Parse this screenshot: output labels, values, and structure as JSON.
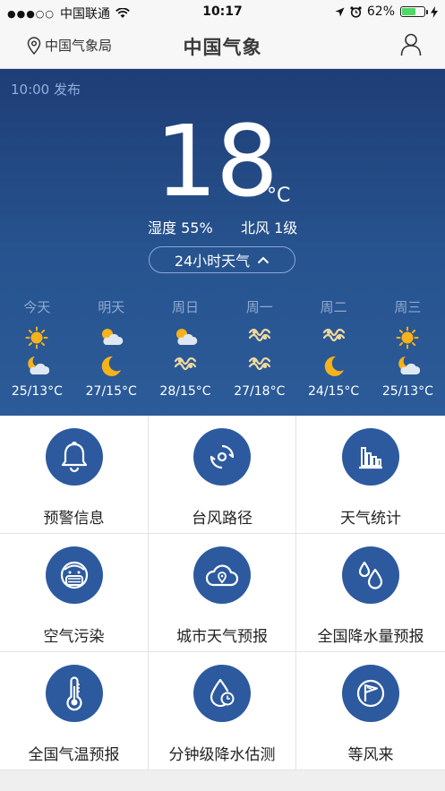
{
  "status": {
    "carrier": "中国联通",
    "time": "10:17",
    "battery": "62%",
    "battery_level": 0.62
  },
  "nav": {
    "location": "中国气象局",
    "logo": "中国气象"
  },
  "weather": {
    "published": "10:00 发布",
    "temperature": "18",
    "unit": "°C",
    "humidity": "湿度 55%",
    "wind": "北风 1级",
    "toggle_label": "24小时天气"
  },
  "forecast": [
    {
      "day": "今天",
      "day_icon": "sun-icon",
      "night_icon": "cloudy-moon-icon",
      "temps": "25/13°C"
    },
    {
      "day": "明天",
      "day_icon": "sun-cloud-icon",
      "night_icon": "moon-icon",
      "temps": "27/15°C"
    },
    {
      "day": "周日",
      "day_icon": "sun-cloud-icon",
      "night_icon": "haze-icon",
      "temps": "28/15°C"
    },
    {
      "day": "周一",
      "day_icon": "haze-icon",
      "night_icon": "haze-icon",
      "temps": "27/18°C"
    },
    {
      "day": "周二",
      "day_icon": "haze-icon",
      "night_icon": "moon-icon",
      "temps": "24/15°C"
    },
    {
      "day": "周三",
      "day_icon": "sun-icon",
      "night_icon": "cloudy-moon-icon",
      "temps": "25/13°C"
    }
  ],
  "services": [
    {
      "label": "预警信息",
      "icon": "bell-icon"
    },
    {
      "label": "台风路径",
      "icon": "typhoon-icon"
    },
    {
      "label": "天气统计",
      "icon": "bar-chart-icon"
    },
    {
      "label": "空气污染",
      "icon": "mask-face-icon"
    },
    {
      "label": "城市天气预报",
      "icon": "cloud-location-icon"
    },
    {
      "label": "全国降水量预报",
      "icon": "raindrops-icon"
    },
    {
      "label": "全国气温预报",
      "icon": "thermometer-icon"
    },
    {
      "label": "分钟级降水估测",
      "icon": "drop-clock-icon"
    },
    {
      "label": "等风来",
      "icon": "wind-flag-icon"
    }
  ],
  "colors": {
    "hero_top": "#1f3d76",
    "hero_bottom": "#2c5b99",
    "icon_circle": "#2d5a9e",
    "sun": "#f6b21b"
  }
}
